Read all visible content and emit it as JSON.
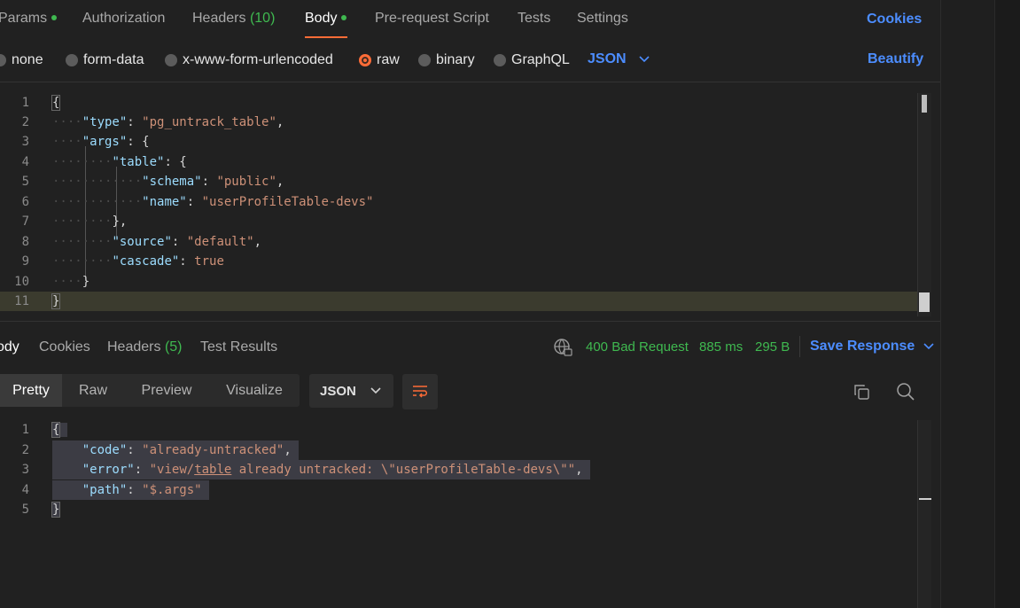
{
  "request_tabs": {
    "params": "Params",
    "authorization": "Authorization",
    "headers": "Headers",
    "headers_count": "(10)",
    "body": "Body",
    "prerequest": "Pre-request Script",
    "tests": "Tests",
    "settings": "Settings",
    "cookies": "Cookies"
  },
  "body_types": {
    "none": "none",
    "form_data": "form-data",
    "urlencoded": "x-www-form-urlencoded",
    "raw": "raw",
    "binary": "binary",
    "graphql": "GraphQL",
    "format": "JSON",
    "beautify": "Beautify"
  },
  "request_body": {
    "line_numbers": [
      "1",
      "2",
      "3",
      "4",
      "5",
      "6",
      "7",
      "8",
      "9",
      "10",
      "11"
    ],
    "k_type": "\"type\"",
    "v_type": "\"pg_untrack_table\"",
    "k_args": "\"args\"",
    "k_table": "\"table\"",
    "k_schema": "\"schema\"",
    "v_schema": "\"public\"",
    "k_name": "\"name\"",
    "v_name": "\"userProfileTable-devs\"",
    "k_source": "\"source\"",
    "v_source": "\"default\"",
    "k_cascade": "\"cascade\"",
    "v_cascade": "true"
  },
  "response_tabs": {
    "body": "ody",
    "cookies": "Cookies",
    "headers": "Headers",
    "headers_count": "(5)",
    "test_results": "Test Results"
  },
  "response_meta": {
    "status": "400 Bad Request",
    "time": "885 ms",
    "size": "295 B",
    "save": "Save Response"
  },
  "response_view": {
    "pretty": "Pretty",
    "raw": "Raw",
    "preview": "Preview",
    "visualize": "Visualize",
    "format": "JSON"
  },
  "response_body": {
    "line_numbers": [
      "1",
      "2",
      "3",
      "4",
      "5"
    ],
    "k_code": "\"code\"",
    "v_code": "\"already-untracked\"",
    "k_error": "\"error\"",
    "v_error_pre": "\"",
    "v_error_view": "view/",
    "v_error_table": "table",
    "v_error_post": " already untracked: \\\"userProfileTable-devs\\\"\"",
    "k_path": "\"path\"",
    "v_path": "\"$.args\""
  },
  "colors": {
    "accent": "#ff6c37",
    "link": "#4c8dff",
    "success": "#3fb950"
  }
}
